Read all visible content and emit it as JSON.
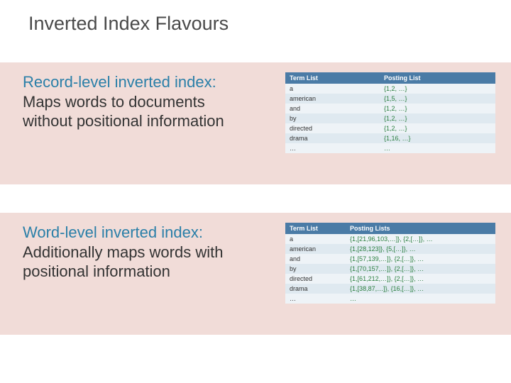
{
  "title": "Inverted Index Flavours",
  "section1": {
    "heading": "Record-level inverted index:",
    "body1": "Maps words to documents",
    "body2": "without positional information",
    "table": {
      "h1": "Term List",
      "h2": "Posting List",
      "r0t": "a",
      "r0p": "{1,2, …}",
      "r1t": "american",
      "r1p": "{1,5, …}",
      "r2t": "and",
      "r2p": "{1,2, …}",
      "r3t": "by",
      "r3p": "{1,2, …}",
      "r4t": "directed",
      "r4p": "{1,2, …}",
      "r5t": "drama",
      "r5p": "{1,16, …}",
      "r6t": "…",
      "r6p": "…"
    }
  },
  "section2": {
    "heading": "Word-level inverted index:",
    "body1": "Additionally maps words with",
    "body2": "positional information",
    "table": {
      "h1": "Term List",
      "h2": "Posting Lists",
      "r0t": "a",
      "r0p": "{1,[21,96,103,…]}, {2,[…]}, …",
      "r1t": "american",
      "r1p": "{1,[28,123]}, {5,[…]}, …",
      "r2t": "and",
      "r2p": "{1,[57,139,…]}, {2,[…]}, …",
      "r3t": "by",
      "r3p": "{1,[70,157,…]}, {2,[…]}, …",
      "r4t": "directed",
      "r4p": "{1,[61,212,…]}, {2,[…]}, …",
      "r5t": "drama",
      "r5p": "{1,[38,87,…]}, {16,[…]}, …",
      "r6t": "…",
      "r6p": "…"
    }
  }
}
